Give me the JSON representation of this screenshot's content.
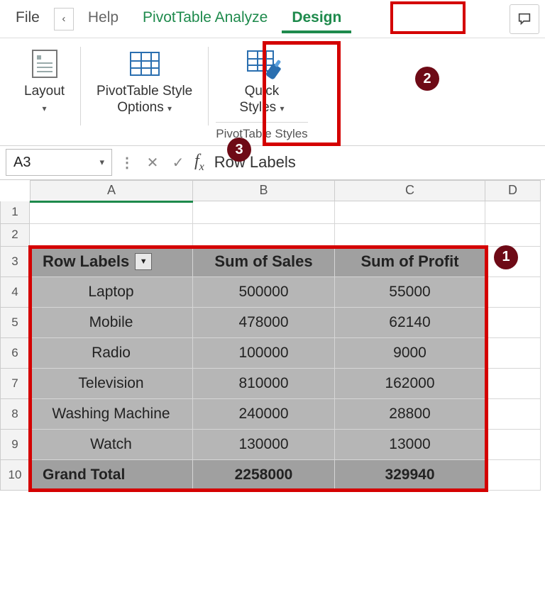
{
  "tabs": {
    "file": "File",
    "help": "Help",
    "analyze": "PivotTable Analyze",
    "design": "Design"
  },
  "ribbon": {
    "layout": "Layout",
    "style_options_1": "PivotTable Style",
    "style_options_2": "Options",
    "quick_1": "Quick",
    "quick_2": "Styles",
    "group_caption": "PivotTable Styles"
  },
  "badges": {
    "one": "1",
    "two": "2",
    "three": "3"
  },
  "namebox": "A3",
  "formula_value": "Row Labels",
  "cols": {
    "A": "A",
    "B": "B",
    "C": "C",
    "D": "D"
  },
  "rownums": [
    "1",
    "2",
    "3",
    "4",
    "5",
    "6",
    "7",
    "8",
    "9",
    "10"
  ],
  "pivot": {
    "headers": {
      "row": "Row Labels",
      "sales": "Sum of Sales",
      "profit": "Sum of Profit"
    },
    "rows": [
      {
        "label": "Laptop",
        "sales": "500000",
        "profit": "55000"
      },
      {
        "label": "Mobile",
        "sales": "478000",
        "profit": "62140"
      },
      {
        "label": "Radio",
        "sales": "100000",
        "profit": "9000"
      },
      {
        "label": "Television",
        "sales": "810000",
        "profit": "162000"
      },
      {
        "label": "Washing Machine",
        "sales": "240000",
        "profit": "28800"
      },
      {
        "label": "Watch",
        "sales": "130000",
        "profit": "13000"
      }
    ],
    "total": {
      "label": "Grand Total",
      "sales": "2258000",
      "profit": "329940"
    }
  }
}
